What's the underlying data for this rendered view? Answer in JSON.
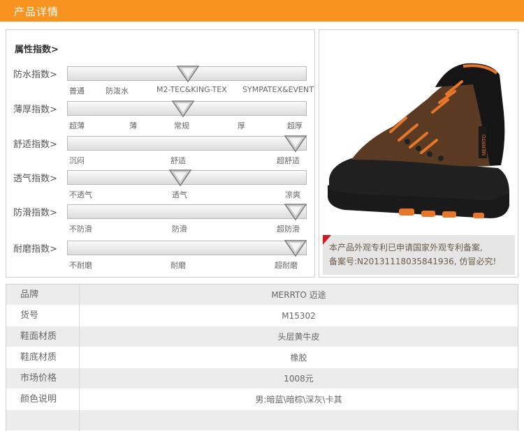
{
  "header": {
    "title": "产品详情"
  },
  "attributes": {
    "heading": "属性指数>",
    "rows": [
      {
        "label": "防水指数>",
        "level_percent": 50,
        "scale": [
          "普通",
          "防泼水",
          "M2-TEC&KING-TEX",
          "SYMPATEX&EVENT"
        ]
      },
      {
        "label": "薄厚指数>",
        "level_percent": 48,
        "scale": [
          "超薄",
          "薄",
          "常规",
          "厚",
          "超厚"
        ]
      },
      {
        "label": "舒适指数>",
        "level_percent": 96,
        "scale": [
          "沉闷",
          "舒适",
          "超舒适"
        ]
      },
      {
        "label": "透气指数>",
        "level_percent": 47,
        "scale": [
          "不透气",
          "透气",
          "凉爽"
        ]
      },
      {
        "label": "防滑指数>",
        "level_percent": 95,
        "scale": [
          "不防滑",
          "防滑",
          "超防滑"
        ]
      },
      {
        "label": "耐磨指数>",
        "level_percent": 95,
        "scale": [
          "不耐磨",
          "耐磨",
          "超耐磨"
        ]
      }
    ]
  },
  "photo": {
    "alt": "MERRTO hiking boot",
    "boot_logo": "MERRTO",
    "notice_line1": "本产品外观专利已申请国家外观专利备案,",
    "notice_line2": "备案号:N20131118035841936, 仿冒必究!"
  },
  "specs": [
    {
      "key": "品牌",
      "value": "MERRTO 迈途"
    },
    {
      "key": "货号",
      "value": "M15302"
    },
    {
      "key": "鞋面材质",
      "value": "头层黄牛皮"
    },
    {
      "key": "鞋底材质",
      "value": "橡胶"
    },
    {
      "key": "市场价格",
      "value": "1008元"
    },
    {
      "key": "颜色说明",
      "value": "男:暗蓝\\暗棕\\深灰\\卡其"
    }
  ],
  "colors": {
    "header": "#f7931e",
    "notice_corner": "#d7181f",
    "boot_leather": "#5a3a22",
    "boot_accent": "#e8762a"
  }
}
